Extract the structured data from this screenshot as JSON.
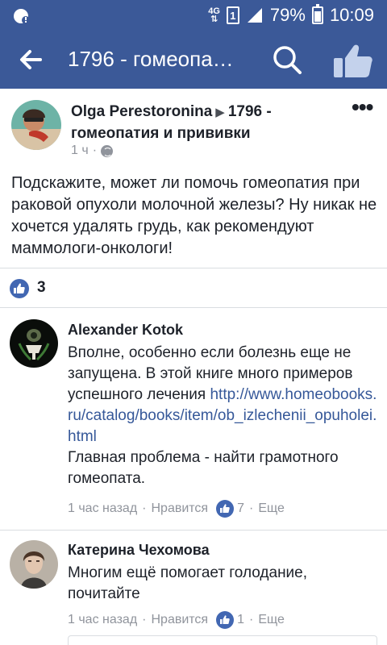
{
  "status_bar": {
    "network": "4G",
    "sim": "1",
    "battery": "79%",
    "time": "10:09"
  },
  "header": {
    "title": "1796 - гомеопа…"
  },
  "post": {
    "author": "Olga Perestoronina",
    "group": "1796 - гомеопатия и прививки",
    "time": "1 ч",
    "dot": "·",
    "text": "Подскажите, может ли помочь гомеопатия при раковой опухоли молочной железы? Ну никак не хочется удалять грудь, как рекомендуют маммологи-онкологи!",
    "reaction_count": "3"
  },
  "comments": [
    {
      "author": "Alexander Kotok",
      "text_before": "Вполне, особенно если болезнь еще не запущена. В этой книге много примеров успешного лечения ",
      "link": "http://www.homeobooks.ru/catalog/books/item/ob_izlechenii_opuholei.html",
      "text_after": "Главная проблема - найти грамотного гомеопата.",
      "time": "1 час назад",
      "like_label": "Нравится",
      "likes": "7",
      "more_label": "Еще"
    },
    {
      "author": "Катерина Чехомова",
      "text": "Многим ещё помогает голодание, почитайте",
      "time": "1 час назад",
      "like_label": "Нравится",
      "likes": "1",
      "more_label": "Еще"
    }
  ],
  "meta_separator": "·",
  "colors": {
    "brand": "#3b5998",
    "link": "#365899",
    "like": "#4267b2",
    "meta": "#90949c"
  },
  "icons": {
    "status_left": "shield-alert-icon",
    "back": "back-arrow-icon",
    "search": "search-icon",
    "like_page": "thumbs-up-icon",
    "more": "more-dots-icon",
    "privacy": "globe-icon"
  }
}
